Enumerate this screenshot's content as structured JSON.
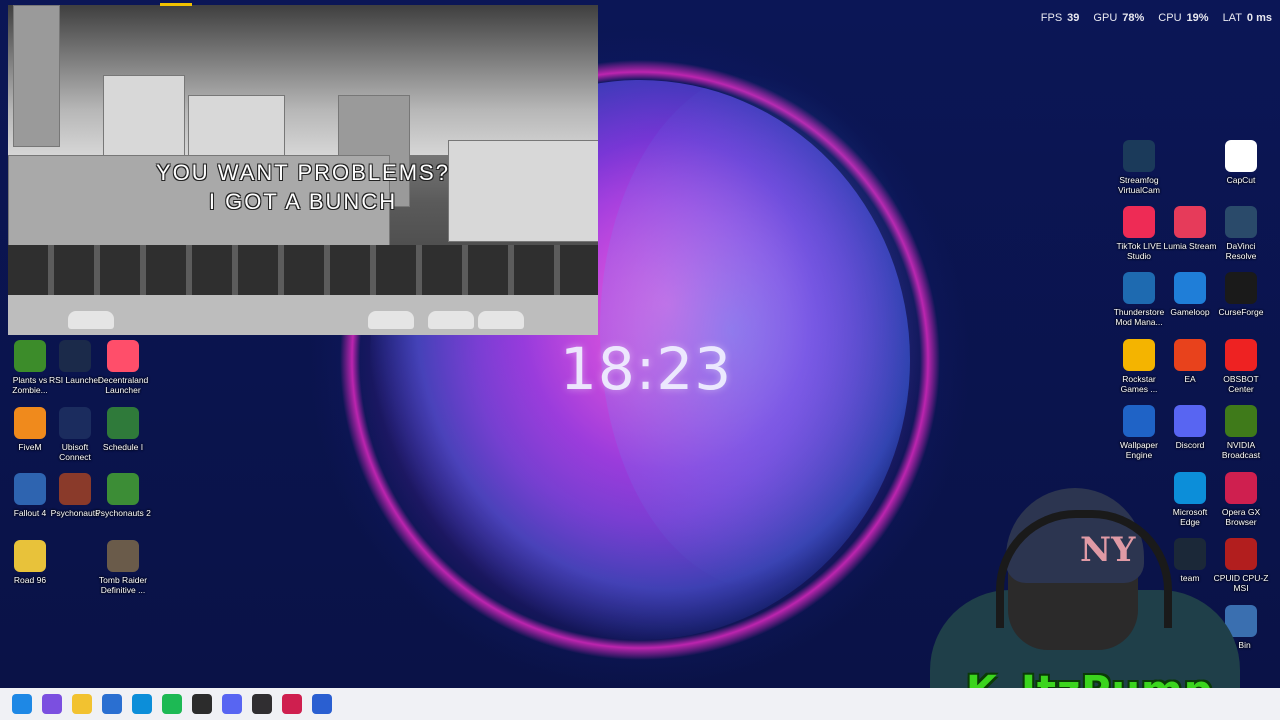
{
  "overlay": {
    "stats": [
      {
        "label": "FPS",
        "value": "39"
      },
      {
        "label": "GPU",
        "value": "78%"
      },
      {
        "label": "CPU",
        "value": "19%"
      },
      {
        "label": "LAT",
        "value": "0 ms"
      }
    ]
  },
  "video": {
    "caption_line1": "YOU WANT PROBLEMS?",
    "caption_line2": "I GOT A BUNCH"
  },
  "clock": {
    "time": "18:23"
  },
  "desktop_left": [
    {
      "label": "Plants vs Zombie...",
      "icon": "plants-vs-zombies-icon",
      "color": "#3c8c2a"
    },
    {
      "label": "RSI Launcher",
      "icon": "rsi-launcher-icon",
      "color": "#1b2a4a"
    },
    {
      "label": "Decentraland Launcher",
      "icon": "decentraland-icon",
      "color": "#ff4e6a"
    },
    {
      "label": "FiveM",
      "icon": "fivem-icon",
      "color": "#f08a1c"
    },
    {
      "label": "Ubisoft Connect",
      "icon": "ubisoft-icon",
      "color": "#1b2c5e"
    },
    {
      "label": "Schedule I",
      "icon": "schedule-icon",
      "color": "#2f7a3a"
    },
    {
      "label": "Fallout 4",
      "icon": "fallout-icon",
      "color": "#2e64b0"
    },
    {
      "label": "Psychonauts",
      "icon": "psychonauts-icon",
      "color": "#8a3a2a"
    },
    {
      "label": "Psychonauts 2",
      "icon": "psychonauts2-icon",
      "color": "#3c8d36"
    },
    {
      "label": "Road 96",
      "icon": "road96-icon",
      "color": "#e8c23a"
    },
    {
      "label": "Tomb Raider Definitive ...",
      "icon": "tomb-raider-icon",
      "color": "#6a5b4a"
    }
  ],
  "desktop_right": [
    {
      "label": "Streamfog VirtualCam",
      "icon": "streamfog-icon",
      "color": "#1b3a5a"
    },
    {
      "label": "CapCut",
      "icon": "capcut-icon",
      "color": "#ffffff"
    },
    {
      "label": "TikTok LIVE Studio",
      "icon": "tiktok-icon",
      "color": "#ee2b55"
    },
    {
      "label": "Lumia Stream",
      "icon": "lumia-icon",
      "color": "#e63b5a"
    },
    {
      "label": "DaVinci Resolve",
      "icon": "davinci-icon",
      "color": "#2a4a6a"
    },
    {
      "label": "Thunderstore Mod Mana...",
      "icon": "thunderstore-icon",
      "color": "#1e6ab0"
    },
    {
      "label": "Gameloop",
      "icon": "gameloop-icon",
      "color": "#1f7ed8"
    },
    {
      "label": "CurseForge",
      "icon": "curseforge-icon",
      "color": "#1a1a1a"
    },
    {
      "label": "Rockstar Games ...",
      "icon": "rockstar-icon",
      "color": "#f4b400"
    },
    {
      "label": "EA",
      "icon": "ea-icon",
      "color": "#e8421c"
    },
    {
      "label": "OBSBOT Center",
      "icon": "obsbot-icon",
      "color": "#e22"
    },
    {
      "label": "Wallpaper Engine",
      "icon": "wallpaper-engine-icon",
      "color": "#1f63c6"
    },
    {
      "label": "Discord",
      "icon": "discord-icon",
      "color": "#5865f2"
    },
    {
      "label": "NVIDIA Broadcast",
      "icon": "nvidia-icon",
      "color": "#3f7a1a"
    },
    {
      "label": "Microsoft Edge",
      "icon": "edge-icon",
      "color": "#0c8ed9"
    },
    {
      "label": "Opera GX Browser",
      "icon": "opera-gx-icon",
      "color": "#cf1f4f"
    },
    {
      "label": "team",
      "icon": "steam-icon",
      "color": "#1b2838"
    },
    {
      "label": "CPUID CPU-Z MSI",
      "icon": "cpuz-icon",
      "color": "#b21e1e"
    },
    {
      "label": "e Bin",
      "icon": "recycle-bin-icon",
      "color": "#3a6fb0"
    }
  ],
  "webcam": {
    "name": "ItzPump",
    "badge": "K",
    "cap_logo": "NY"
  },
  "taskbar": {
    "items": [
      {
        "icon": "windows-start-icon",
        "color": "#1e88e5"
      },
      {
        "icon": "copilot-icon",
        "color": "#7b4fe0"
      },
      {
        "icon": "file-explorer-icon",
        "color": "#f2c230"
      },
      {
        "icon": "store-icon",
        "color": "#2a6fd1"
      },
      {
        "icon": "edge-icon",
        "color": "#0c8ed9"
      },
      {
        "icon": "spotify-icon",
        "color": "#1db954"
      },
      {
        "icon": "terminal-icon",
        "color": "#2c2c2c"
      },
      {
        "icon": "discord-icon",
        "color": "#5865f2"
      },
      {
        "icon": "obs-icon",
        "color": "#302e31"
      },
      {
        "icon": "opera-gx-icon",
        "color": "#cf1f4f"
      },
      {
        "icon": "network-icon",
        "color": "#2a5fd1"
      }
    ]
  }
}
